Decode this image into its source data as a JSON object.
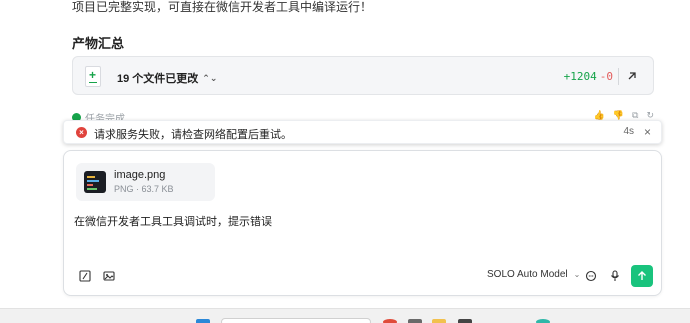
{
  "intro_text": "项目已完整实现，可直接在微信开发者工具中编译运行！",
  "section_title": "产物汇总",
  "summary": {
    "files_changed": "19 个文件已更改",
    "additions": "+1204",
    "deletions": "-0"
  },
  "task": {
    "status": "任务完成"
  },
  "toast": {
    "message": "请求服务失败，请检查网络配置后重试。",
    "timer": "4s",
    "close": "×"
  },
  "composer": {
    "attachment": {
      "name": "image.png",
      "meta": "PNG · 63.7 KB"
    },
    "prompt": "在微信开发者工具工具调试时，提示错误",
    "model": "SOLO Auto Model"
  },
  "colors": {
    "accent": "#19c37d",
    "addition": "#16a34a",
    "deletion": "#e35d5d",
    "error": "#e0433c"
  }
}
